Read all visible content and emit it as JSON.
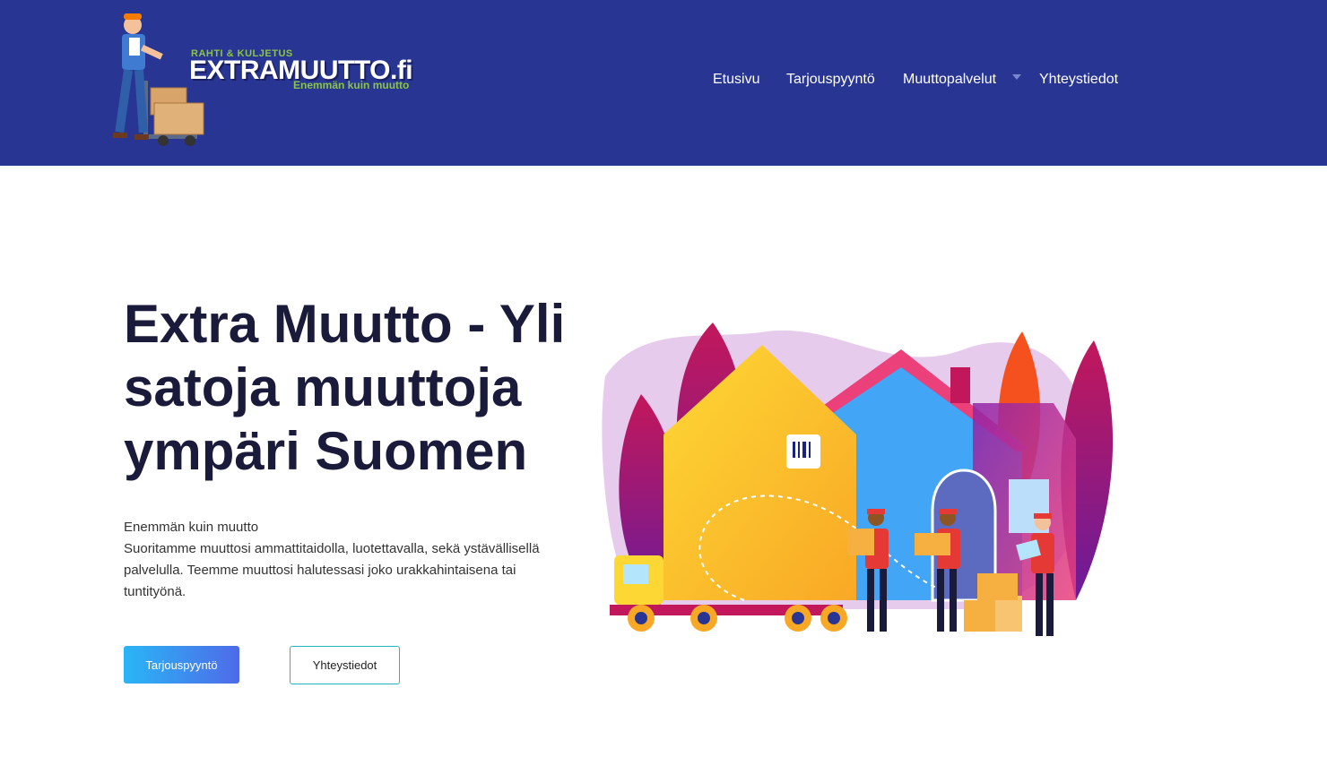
{
  "brand": {
    "small_text": "RAHTI & KULJETUS",
    "name": "EXTRAMUUTTO.fi",
    "tagline": "Enemmän kuin muutto"
  },
  "nav": {
    "items": [
      {
        "label": "Etusivu"
      },
      {
        "label": "Tarjouspyyntö"
      },
      {
        "label": "Muuttopalvelut"
      },
      {
        "label": "Yhteystiedot"
      }
    ]
  },
  "hero": {
    "title": "Extra Muutto - Yli satoja muuttoja ympäri Suomen",
    "subtitle": "Enemmän kuin muutto",
    "body": "Suoritamme muuttosi ammattitaidolla, luotettavalla, sekä ystävällisellä palvelulla. Teemme muuttosi halutessasi joko urakkahintaisena tai tuntityönä.",
    "primary_button": "Tarjouspyyntö",
    "secondary_button": "Yhteystiedot"
  },
  "colors": {
    "header_bg": "#283593",
    "brand_green": "#8bc34a",
    "title_text": "#1a1a3a",
    "button_gradient_start": "#29b6f6",
    "button_gradient_end": "#4f6ae8",
    "outline_button_border": "#26b6c6"
  }
}
